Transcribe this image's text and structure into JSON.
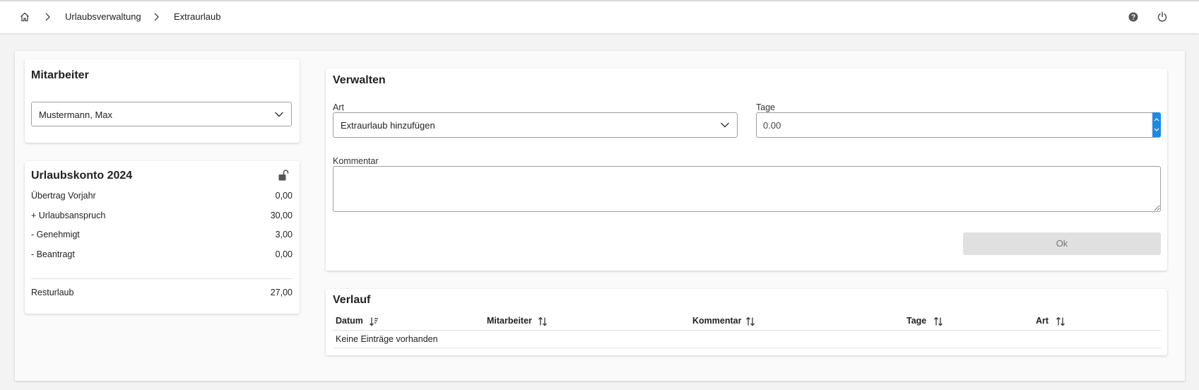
{
  "breadcrumb": {
    "home_icon": "home-icon",
    "items": [
      "Urlaubsverwaltung",
      "Extraurlaub"
    ]
  },
  "topbar": {
    "help_icon": "help-icon",
    "power_icon": "power-icon"
  },
  "employee_card": {
    "title": "Mitarbeiter",
    "selected": "Mustermann, Max"
  },
  "account_card": {
    "title": "Urlaubskonto 2024",
    "lock_icon": "unlock-icon",
    "rows": [
      {
        "label": "Übertrag Vorjahr",
        "value": "0,00"
      },
      {
        "label": "+ Urlaubsanspruch",
        "value": "30,00"
      },
      {
        "label": "- Genehmigt",
        "value": "3,00"
      },
      {
        "label": "- Beantragt",
        "value": "0,00"
      }
    ],
    "rest": {
      "label": "Resturlaub",
      "value": "27,00"
    }
  },
  "manage_card": {
    "title": "Verwalten",
    "art_label": "Art",
    "art_value": "Extraurlaub hinzufügen",
    "tage_label": "Tage",
    "tage_value": "0.00",
    "comment_label": "Kommentar",
    "comment_value": "",
    "ok_label": "Ok"
  },
  "history_card": {
    "title": "Verlauf",
    "columns": [
      {
        "label": "Datum",
        "sort": "desc"
      },
      {
        "label": "Mitarbeiter",
        "sort": "none"
      },
      {
        "label": "Kommentar",
        "sort": "none"
      },
      {
        "label": "Tage",
        "sort": "none"
      },
      {
        "label": "Art",
        "sort": "none"
      }
    ],
    "empty_text": "Keine Einträge vorhanden"
  },
  "colors": {
    "accent": "#1e88e5",
    "button_disabled": "#e0e0e0",
    "background": "#f3f3f3"
  }
}
